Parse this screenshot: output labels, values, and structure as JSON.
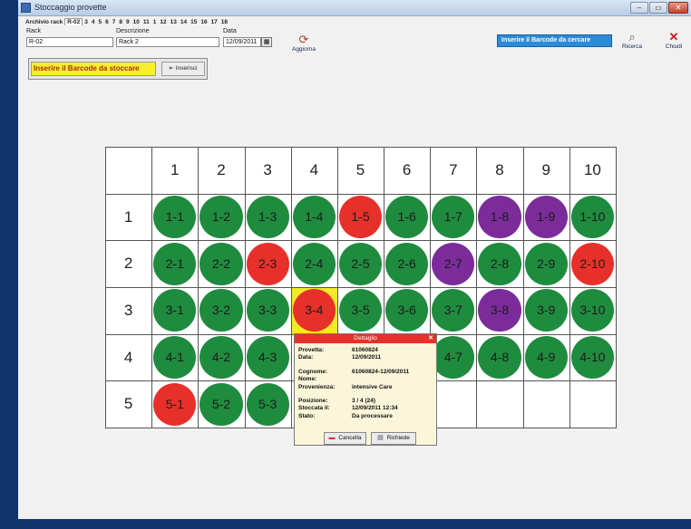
{
  "window": {
    "title": "Stoccaggio provette",
    "controls": [
      "–",
      "▭",
      "✕"
    ]
  },
  "tabs": [
    "Archivio rack",
    "R-02",
    "3",
    "4",
    "5",
    "6",
    "7",
    "8",
    "9",
    "10",
    "11",
    "1",
    "12",
    "13",
    "14",
    "15",
    "16",
    "17",
    "18"
  ],
  "active_tab": "R-02",
  "form": {
    "rack_label": "Rack",
    "rack_value": "R-02",
    "desc_label": "Descrizione",
    "desc_value": "Rack 2",
    "date_label": "Data",
    "date_value": "12/09/2011",
    "calendar_icon": "▦"
  },
  "toolbar": {
    "aggiorna_label": "Aggiorna",
    "aggiorna_icon": "⟳",
    "ricerca_label": "Ricerca",
    "ricerca_icon": "⌕",
    "chiudi_label": "Chiudi",
    "chiudi_icon": "✕"
  },
  "search_text": "Inserire il Barcode da cercare",
  "store": {
    "input_text": "Inserire il Barcode da stoccare",
    "button_label": "Inserisci",
    "button_icon": "⇤"
  },
  "status_colors": {
    "green": "#1f8b3e",
    "red": "#e8302a",
    "purple": "#7b2c9a",
    "highlight": "#f2e928"
  },
  "rack_grid": {
    "columns": [
      "1",
      "2",
      "3",
      "4",
      "5",
      "6",
      "7",
      "8",
      "9",
      "10"
    ],
    "rows": [
      "1",
      "2",
      "3",
      "4",
      "5"
    ],
    "highlighted_cell": "3-4",
    "cells": [
      [
        "green",
        "green",
        "green",
        "green",
        "red",
        "green",
        "green",
        "purple",
        "purple",
        "green"
      ],
      [
        "green",
        "green",
        "red",
        "green",
        "green",
        "green",
        "purple",
        "green",
        "green",
        "red"
      ],
      [
        "green",
        "green",
        "green",
        "red",
        "green",
        "green",
        "green",
        "purple",
        "green",
        "green"
      ],
      [
        "green",
        "green",
        "green",
        "",
        "",
        "",
        "green",
        "green",
        "green",
        "green"
      ],
      [
        "red",
        "green",
        "green",
        "",
        "",
        "",
        "",
        "",
        "",
        ""
      ]
    ]
  },
  "detail_popup": {
    "title": "Dettaglio",
    "close_icon": "✕",
    "fields": [
      {
        "label": "Provetta:",
        "value": "61060824"
      },
      {
        "label": "Data:",
        "value": "12/09/2011"
      },
      {
        "label": "Cognome:",
        "value": "61060824-12/09/2011"
      },
      {
        "label": "Nome:",
        "value": ""
      },
      {
        "label": "Provenienza:",
        "value": "intensive Care"
      },
      {
        "label": "Posizione:",
        "value": "3 / 4 (24)"
      },
      {
        "label": "Stoccata il:",
        "value": "12/09/2011 12:34"
      },
      {
        "label": "Stato:",
        "value": "Da processare"
      }
    ],
    "cancel_label": "Cancella",
    "cancel_icon": "▬",
    "request_label": "Richiede",
    "request_icon": "▤"
  }
}
